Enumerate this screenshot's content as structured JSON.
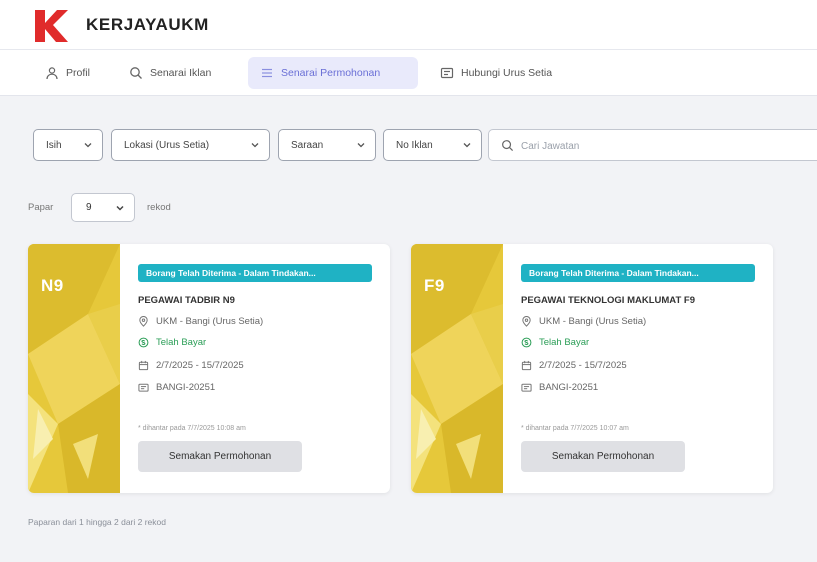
{
  "brand": {
    "name": "KERJAYAUKM",
    "logo_color": "#e02b2b"
  },
  "nav": {
    "items": [
      {
        "label": "Profil",
        "icon": "user-icon"
      },
      {
        "label": "Senarai Iklan",
        "icon": "search-icon"
      },
      {
        "label": "Senarai Permohonan",
        "icon": "list-icon",
        "active": true
      },
      {
        "label": "Hubungi Urus Setia",
        "icon": "contact-card-icon"
      }
    ]
  },
  "filters": {
    "items": [
      {
        "label": "Isih"
      },
      {
        "label": "Lokasi (Urus Setia)"
      },
      {
        "label": "Saraan"
      },
      {
        "label": "No Iklan"
      }
    ],
    "search_placeholder": "Cari Jawatan"
  },
  "paging": {
    "label": "Papar",
    "value": "9",
    "suffix": "rekod"
  },
  "cards": [
    {
      "grade": "N9",
      "badge": "Borang Telah Diterima - Dalam Tindakan...",
      "title": "PEGAWAI TADBIR N9",
      "location": "UKM - Bangi (Urus Setia)",
      "payment": "Telah Bayar",
      "dates": "2/7/2025 - 15/7/2025",
      "code": "BANGI-20251",
      "note": "* dihantar pada 7/7/2025 10:08 am",
      "button": "Semakan Permohonan"
    },
    {
      "grade": "F9",
      "badge": "Borang Telah Diterima - Dalam Tindakan...",
      "title": "PEGAWAI TEKNOLOGI MAKLUMAT F9",
      "location": "UKM - Bangi (Urus Setia)",
      "payment": "Telah Bayar",
      "dates": "2/7/2025 - 15/7/2025",
      "code": "BANGI-20251",
      "note": "* dihantar pada 7/7/2025 10:07 am",
      "button": "Semakan Permohonan"
    }
  ],
  "footer": {
    "text": "Paparan dari 1 hingga 2 dari 2 rekod"
  },
  "colors": {
    "accent": "#6a6fd6",
    "badge": "#1fb2c4",
    "status_green": "#2a9d56",
    "card_gold": "#e6c83a"
  }
}
